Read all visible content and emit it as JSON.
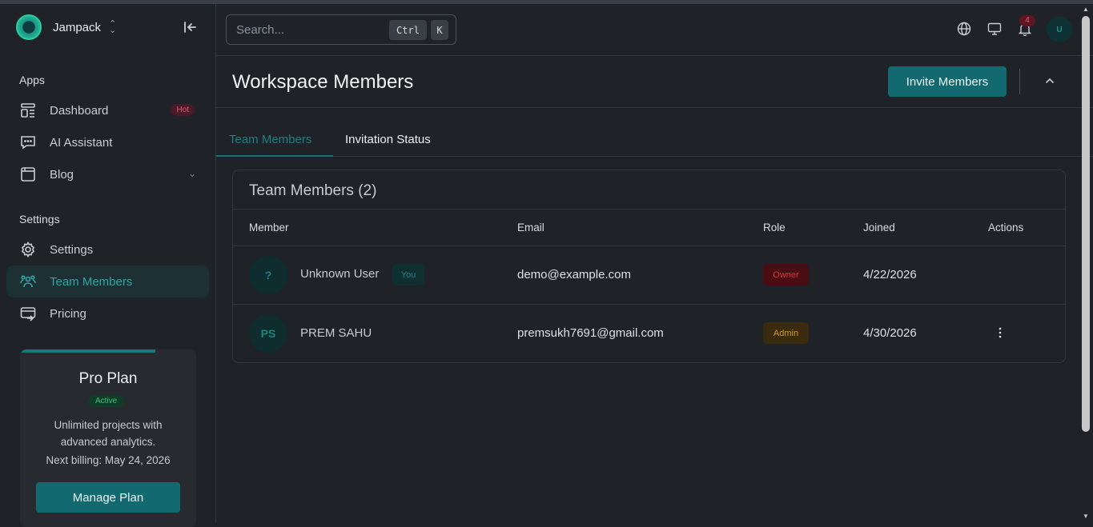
{
  "brand": {
    "name": "Jampack"
  },
  "sidebar": {
    "apps_title": "Apps",
    "settings_title": "Settings",
    "items": [
      {
        "label": "Dashboard",
        "icon": "dashboard-icon",
        "badge": "Hot"
      },
      {
        "label": "AI Assistant",
        "icon": "chat-icon"
      },
      {
        "label": "Blog",
        "icon": "browser-window-icon"
      },
      {
        "label": "Settings",
        "icon": "gear-icon"
      },
      {
        "label": "Team Members",
        "icon": "users-icon",
        "active": true
      },
      {
        "label": "Pricing",
        "icon": "credit-card-icon"
      }
    ],
    "plan": {
      "title": "Pro Plan",
      "status": "Active",
      "description": "Unlimited projects with advanced analytics.",
      "next_billing": "Next billing: May 24, 2026",
      "button": "Manage Plan"
    }
  },
  "topbar": {
    "search_placeholder": "Search...",
    "shortcut_ctrl": "Ctrl",
    "shortcut_k": "K",
    "notification_count": "4",
    "avatar_initial": "U"
  },
  "page": {
    "title": "Workspace Members",
    "invite_button": "Invite Members"
  },
  "tabs": [
    {
      "label": "Team Members",
      "active": true
    },
    {
      "label": "Invitation Status",
      "active": false
    }
  ],
  "card": {
    "title": "Team Members (2)",
    "headers": [
      "Member",
      "Email",
      "Role",
      "Joined",
      "Actions"
    ],
    "rows": [
      {
        "initials": "?",
        "name": "Unknown User",
        "tag": "You",
        "email": "demo@example.com",
        "role": "Owner",
        "joined": "4/22/2026"
      },
      {
        "initials": "PS",
        "name": "PREM SAHU",
        "tag": "",
        "email": "premsukh7691@gmail.com",
        "role": "Admin",
        "joined": "4/30/2026"
      }
    ]
  },
  "colors": {
    "accent": "#12696f",
    "background": "#1f2226",
    "owner_badge": "#d9333f",
    "admin_badge": "#d2962c"
  }
}
